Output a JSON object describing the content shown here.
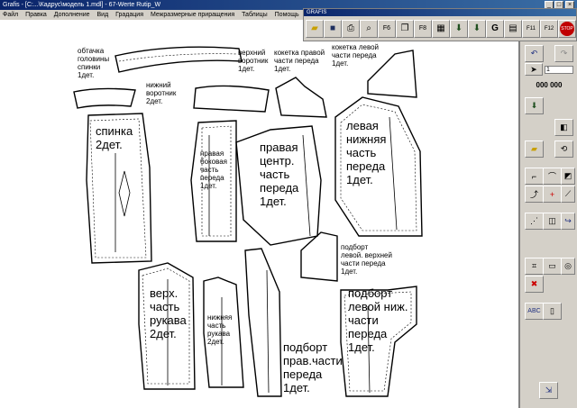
{
  "window": {
    "title": "Grafis - [C:...\\Кадрус\\модель 1.mdl] - 67-Werte Rutip_W"
  },
  "menu": [
    "Файл",
    "Правка",
    "Дополнение",
    "Вид",
    "Градация",
    "Межразмерные приращения",
    "Таблицы",
    "Помощь"
  ],
  "toolbar": {
    "caption": "GRAFIS",
    "buttons": [
      {
        "icon": "open-folder-icon",
        "label": ""
      },
      {
        "icon": "save-icon",
        "label": ""
      },
      {
        "icon": "print-icon",
        "label": ""
      },
      {
        "icon": "zoom-icon",
        "label": ""
      },
      {
        "icon": "f6-icon",
        "label": "F6"
      },
      {
        "icon": "copy-icon",
        "label": ""
      },
      {
        "icon": "f8-icon",
        "label": "F8"
      },
      {
        "icon": "grid-icon",
        "label": ""
      },
      {
        "icon": "download-icon",
        "label": ""
      },
      {
        "icon": "download2-icon",
        "label": ""
      },
      {
        "icon": "g-icon",
        "label": "G"
      },
      {
        "icon": "table-icon",
        "label": ""
      },
      {
        "icon": "f11-icon",
        "label": "F11"
      },
      {
        "icon": "f12-icon",
        "label": "F12"
      },
      {
        "icon": "stop-icon",
        "label": "STOP"
      }
    ]
  },
  "panel": {
    "coord_value": "1",
    "counter": "000 000"
  },
  "pieces": [
    {
      "id": "obtachka",
      "text": "обтачка\nголовины\nспинки\n1дет."
    },
    {
      "id": "nizh-vorotnik",
      "text": "нижний\nворотник\n2дет."
    },
    {
      "id": "verh-vorotnik",
      "text": "верхний\nворотник\n1дет."
    },
    {
      "id": "koketka-prav",
      "text": "кокетка правой\nчасти переда\n1дет."
    },
    {
      "id": "koketka-lev",
      "text": "кокетка левой\nчасти переда\n1дет."
    },
    {
      "id": "spinka",
      "text": "спинка\n2дет."
    },
    {
      "id": "bokovaya",
      "text": "правая\nбоковая\nчасть\nпереда\n1дет."
    },
    {
      "id": "prav-centr",
      "text": "правая\nцентр.\nчасть\nпереда\n1дет."
    },
    {
      "id": "lev-nizh",
      "text": "левая\nнижняя\nчасть\nпереда\n1дет."
    },
    {
      "id": "podbort-lev-verh",
      "text": "подборт\nлевой. верхней\nчасти переда\n1дет."
    },
    {
      "id": "verh-rukav",
      "text": "верх.\nчасть\nрукава\n2дет."
    },
    {
      "id": "nizh-rukav",
      "text": "нижняя\nчасть\nрукава\n2дет."
    },
    {
      "id": "podbort-prav",
      "text": "подборт\nправ.части\nпереда\n1дет."
    },
    {
      "id": "podbort-lev-nizh",
      "text": "подборт\nлевой ниж.\nчасти\nпереда\n1дет."
    }
  ]
}
